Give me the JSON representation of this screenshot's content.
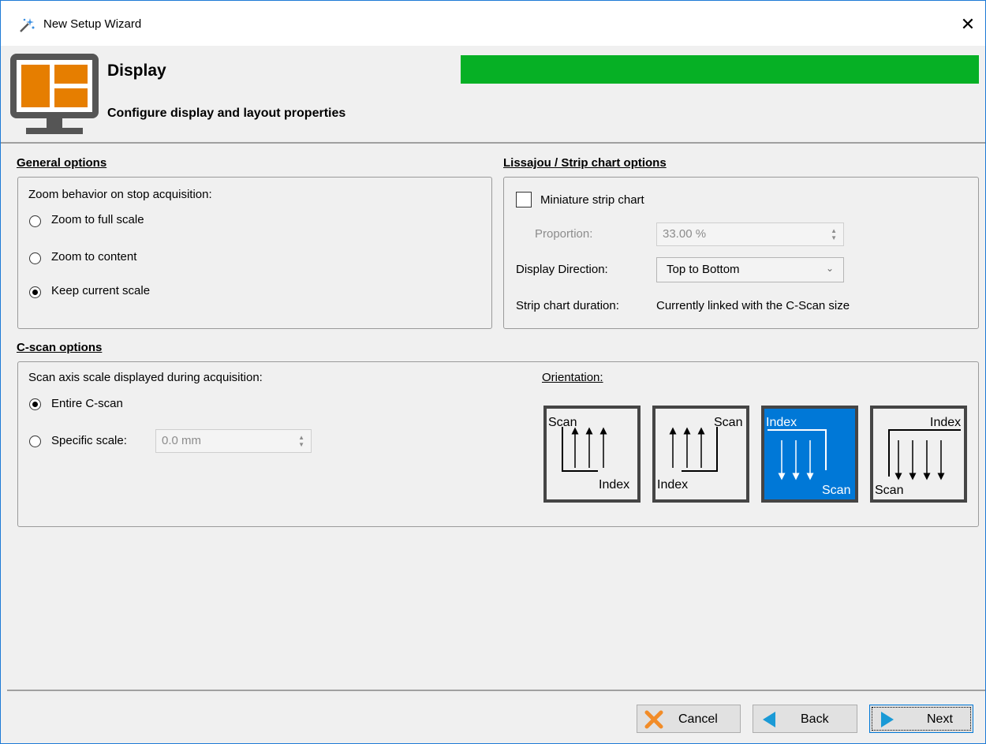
{
  "window": {
    "title": "New Setup Wizard"
  },
  "header": {
    "title": "Display",
    "subtitle": "Configure display and layout properties",
    "progress": 1.0,
    "progress_color": "#06b025"
  },
  "general": {
    "section_label": "General options",
    "zoom_label": "Zoom behavior on stop acquisition:",
    "options": [
      "Zoom to full scale",
      "Zoom to content",
      "Keep current scale"
    ],
    "selected": "Keep current scale"
  },
  "lissajou": {
    "section_label": "Lissajou / Strip chart options",
    "miniature_label": "Miniature strip chart",
    "miniature_checked": false,
    "proportion_label": "Proportion:",
    "proportion_value": "33.00 %",
    "direction_label": "Display Direction:",
    "direction_value": "Top to Bottom",
    "duration_label": "Strip chart duration:",
    "duration_value": "Currently linked with the C-Scan size"
  },
  "cscan": {
    "section_label": "C-scan options",
    "axis_label": "Scan axis scale displayed during acquisition:",
    "entire_label": "Entire C-scan",
    "specific_label": "Specific scale:",
    "specific_value": "0.0 mm",
    "selected": "Entire C-scan",
    "orientation_label": "Orientation:",
    "orientations": [
      {
        "a": "Scan",
        "b": "Index"
      },
      {
        "a": "Scan",
        "b": "Index"
      },
      {
        "a": "Index",
        "b": "Scan"
      },
      {
        "a": "Index",
        "b": "Scan"
      }
    ],
    "selected_orientation": 2,
    "accent_color": "#0078d7"
  },
  "footer": {
    "cancel": "Cancel",
    "back": "Back",
    "next": "Next"
  }
}
